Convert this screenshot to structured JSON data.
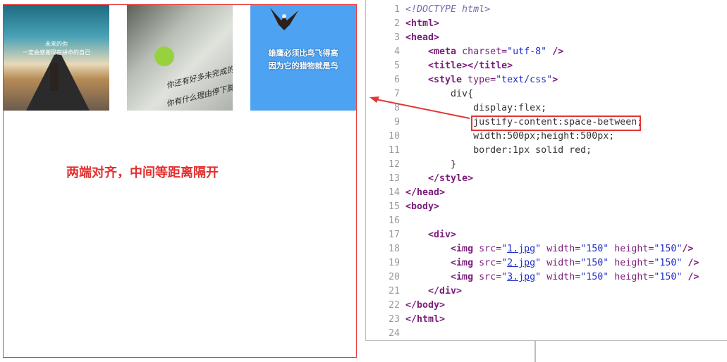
{
  "preview": {
    "caption": "两端对齐，中间等距离隔开",
    "images": [
      {
        "name": "road-photo",
        "lines": [
          "未来的你",
          "一定会感谢现在拼命的自己"
        ]
      },
      {
        "name": "paper-note-photo",
        "lines": [
          "你还有好多未完成的梦",
          "你有什么理由停下脚步"
        ]
      },
      {
        "name": "eagle-photo",
        "lines": [
          "雄鹰必须比鸟飞得高",
          "因为它的猎物就是鸟"
        ]
      }
    ]
  },
  "editor": {
    "lines": [
      {
        "n": "1",
        "html": "<span class='comm'>&lt;!DOCTYPE html&gt;</span>"
      },
      {
        "n": "2",
        "html": "<span class='tag'>&lt;html&gt;</span>"
      },
      {
        "n": "3",
        "html": "<span class='tag'>&lt;head&gt;</span>"
      },
      {
        "n": "4",
        "html": "    <span class='tag'>&lt;meta</span> <span class='attr'>charset=</span><span class='val'>\"utf-8\"</span> <span class='tag'>/&gt;</span>"
      },
      {
        "n": "5",
        "html": "    <span class='tag'>&lt;title&gt;&lt;/title&gt;</span>"
      },
      {
        "n": "6",
        "html": "    <span class='tag'>&lt;style</span> <span class='attr'>type=</span><span class='val'>\"text/css\"</span><span class='tag'>&gt;</span>"
      },
      {
        "n": "7",
        "html": "        <span class='css'>div{</span>"
      },
      {
        "n": "8",
        "html": "            <span class='css'>display:flex;</span>"
      },
      {
        "n": "9",
        "html": "            <span class='css'>justify-content:space-between;</span>"
      },
      {
        "n": "10",
        "html": "            <span class='css'>width:500px;height:500px;</span>"
      },
      {
        "n": "11",
        "html": "            <span class='css'>border:1px solid red;</span>"
      },
      {
        "n": "12",
        "html": "        <span class='css'>}</span>"
      },
      {
        "n": "13",
        "html": "    <span class='tag'>&lt;/style&gt;</span>"
      },
      {
        "n": "14",
        "html": "<span class='tag'>&lt;/head&gt;</span>"
      },
      {
        "n": "15",
        "html": "<span class='tag'>&lt;body&gt;</span>"
      },
      {
        "n": "16",
        "html": ""
      },
      {
        "n": "17",
        "html": "    <span class='tag'>&lt;div&gt;</span>"
      },
      {
        "n": "18",
        "html": "        <span class='tag'>&lt;img</span> <span class='attr'>src=</span><span class='val'>\"<span class='link'>1.jpg</span>\"</span> <span class='attr'>width=</span><span class='val'>\"150\"</span> <span class='attr'>height=</span><span class='val'>\"150\"</span><span class='tag'>/&gt;</span>"
      },
      {
        "n": "19",
        "html": "        <span class='tag'>&lt;img</span> <span class='attr'>src=</span><span class='val'>\"<span class='link'>2.jpg</span>\"</span> <span class='attr'>width=</span><span class='val'>\"150\"</span> <span class='attr'>height=</span><span class='val'>\"150\"</span> <span class='tag'>/&gt;</span>"
      },
      {
        "n": "20",
        "html": "        <span class='tag'>&lt;img</span> <span class='attr'>src=</span><span class='val'>\"<span class='link'>3.jpg</span>\"</span> <span class='attr'>width=</span><span class='val'>\"150\"</span> <span class='attr'>height=</span><span class='val'>\"150\"</span> <span class='tag'>/&gt;</span>"
      },
      {
        "n": "21",
        "html": "    <span class='tag'>&lt;/div&gt;</span>"
      },
      {
        "n": "22",
        "html": "<span class='tag'>&lt;/body&gt;</span>"
      },
      {
        "n": "23",
        "html": "<span class='tag'>&lt;/html&gt;</span>"
      },
      {
        "n": "24",
        "html": ""
      }
    ]
  },
  "colors": {
    "accent_red": "#e53b3b",
    "tag_purple": "#7a1c7a",
    "value_blue": "#1f2fc9",
    "sky_blue": "#4da3f2"
  }
}
